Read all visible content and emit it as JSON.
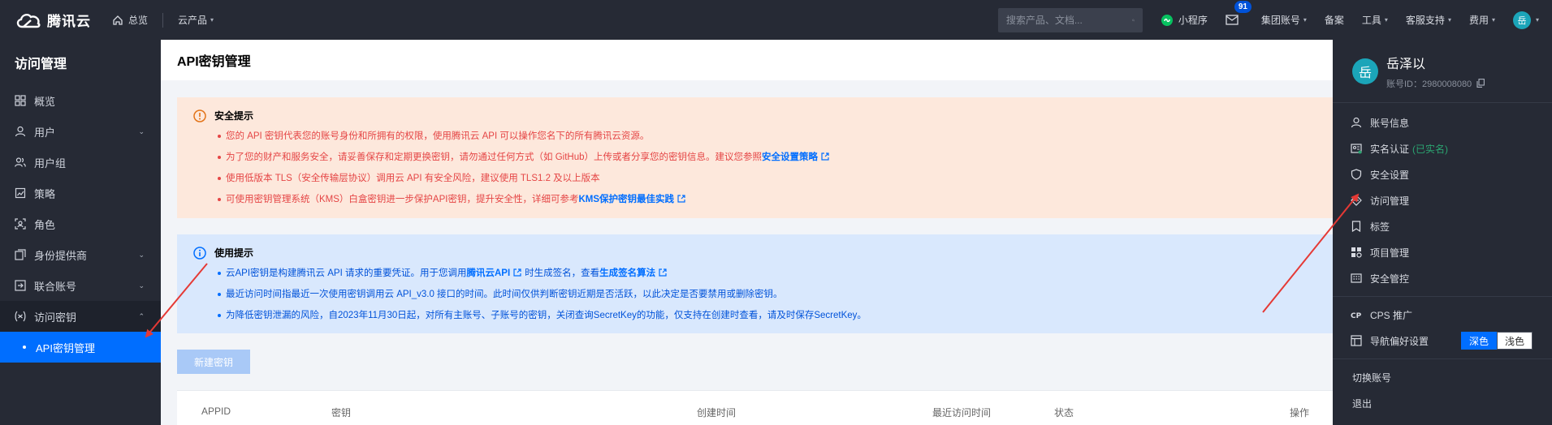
{
  "topbar": {
    "brand": "腾讯云",
    "home_label": "总览",
    "products_label": "云产品",
    "search_placeholder": "搜索产品、文档...",
    "miniprogram_label": "小程序",
    "message_count": "91",
    "group_account_label": "集团账号",
    "beian_label": "备案",
    "tools_label": "工具",
    "support_label": "客服支持",
    "billing_label": "费用",
    "avatar_char": "岳"
  },
  "sidebar": {
    "title": "访问管理",
    "items": [
      {
        "label": "概览",
        "icon": "grid-icon",
        "arrow": ""
      },
      {
        "label": "用户",
        "icon": "user-icon",
        "arrow": "⌄"
      },
      {
        "label": "用户组",
        "icon": "user-group-icon",
        "arrow": ""
      },
      {
        "label": "策略",
        "icon": "policy-icon",
        "arrow": ""
      },
      {
        "label": "角色",
        "icon": "role-icon",
        "arrow": ""
      },
      {
        "label": "身份提供商",
        "icon": "idp-icon",
        "arrow": "⌄"
      },
      {
        "label": "联合账号",
        "icon": "federated-icon",
        "arrow": "⌄"
      },
      {
        "label": "访问密钥",
        "icon": "key-icon",
        "arrow": "⌃"
      }
    ],
    "active_sub": "API密钥管理"
  },
  "main": {
    "title": "API密钥管理",
    "warning": {
      "title": "安全提示",
      "items": [
        {
          "text": "您的 API 密钥代表您的账号身份和所拥有的权限，使用腾讯云 API 可以操作您名下的所有腾讯云资源。",
          "link": ""
        },
        {
          "text": "为了您的财产和服务安全，请妥善保存和定期更换密钥，请勿通过任何方式（如 GitHub）上传或者分享您的密钥信息。建议您参照",
          "link": "安全设置策略"
        },
        {
          "text": "使用低版本 TLS（安全传输层协议）调用云 API 有安全风险，建议使用 TLS1.2 及以上版本",
          "link": ""
        },
        {
          "text": "可使用密钥管理系统（KMS）白盒密钥进一步保护API密钥，提升安全性，详细可参考",
          "link": "KMS保护密钥最佳实践"
        }
      ]
    },
    "info": {
      "title": "使用提示",
      "item1_prefix": "云API密钥是构建腾讯云 API 请求的重要凭证。用于您调用",
      "item1_link1": "腾讯云API",
      "item1_middle": "时生成签名，查看",
      "item1_link2": "生成签名算法",
      "item2": "最近访问时间指最近一次使用密钥调用云 API_v3.0 接口的时间。此时间仅供判断密钥近期是否活跃，以此决定是否要禁用或删除密钥。",
      "item3": "为降低密钥泄漏的风险，自2023年11月30日起，对所有主账号、子账号的密钥，关闭查询SecretKey的功能，仅支持在创建时查看，请及时保存SecretKey。"
    },
    "new_key_button": "新建密钥",
    "table_headers": [
      "APPID",
      "密钥",
      "创建时间",
      "最近访问时间",
      "状态",
      "操作"
    ]
  },
  "account_panel": {
    "avatar_char": "岳",
    "name": "岳泽以",
    "account_id": "账号ID：2980008080",
    "items": [
      {
        "label": "账号信息",
        "icon": "user-icon",
        "extra": ""
      },
      {
        "label": "实名认证",
        "icon": "id-card-icon",
        "extra": "(已实名)"
      },
      {
        "label": "安全设置",
        "icon": "shield-icon",
        "extra": ""
      },
      {
        "label": "访问管理",
        "icon": "access-icon",
        "extra": ""
      },
      {
        "label": "标签",
        "icon": "tag-icon",
        "extra": ""
      },
      {
        "label": "项目管理",
        "icon": "project-icon",
        "extra": ""
      },
      {
        "label": "安全管控",
        "icon": "control-icon",
        "extra": ""
      }
    ],
    "cps_label": "CPS 推广",
    "nav_pref_label": "导航偏好设置",
    "theme_dark": "深色",
    "theme_light": "浅色",
    "switch_account": "切换账号",
    "logout": "退出"
  },
  "colors": {
    "accent": "#006eff",
    "topbar": "#262a35",
    "warning_bg": "#fde8dc",
    "info_bg": "#d9e8fd",
    "annotation": "#e53935"
  }
}
